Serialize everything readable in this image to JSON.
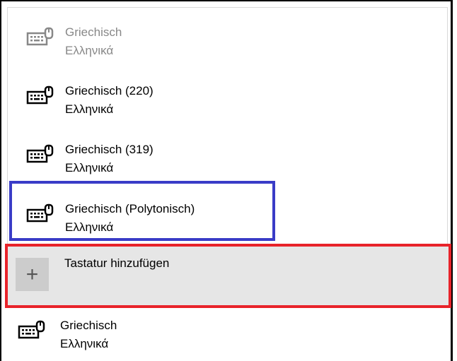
{
  "keyboards": [
    {
      "name": "Griechisch",
      "native": "Ελληνικά",
      "state": "dimmed"
    },
    {
      "name": "Griechisch (220)",
      "native": "Ελληνικά",
      "state": "normal"
    },
    {
      "name": "Griechisch (319)",
      "native": "Ελληνικά",
      "state": "normal"
    },
    {
      "name": "Griechisch (Polytonisch)",
      "native": "Ελληνικά",
      "state": "highlighted"
    }
  ],
  "add_keyboard": {
    "label": "Tastatur hinzufügen",
    "icon": "plus-icon"
  },
  "installed_keyboard": {
    "name": "Griechisch",
    "native": "Ελληνικά"
  },
  "icons": {
    "keyboard": "keyboard-icon"
  },
  "colors": {
    "highlight_blue": "#3a3cc7",
    "highlight_red": "#e8232a",
    "add_row_bg": "#e6e6e6"
  }
}
